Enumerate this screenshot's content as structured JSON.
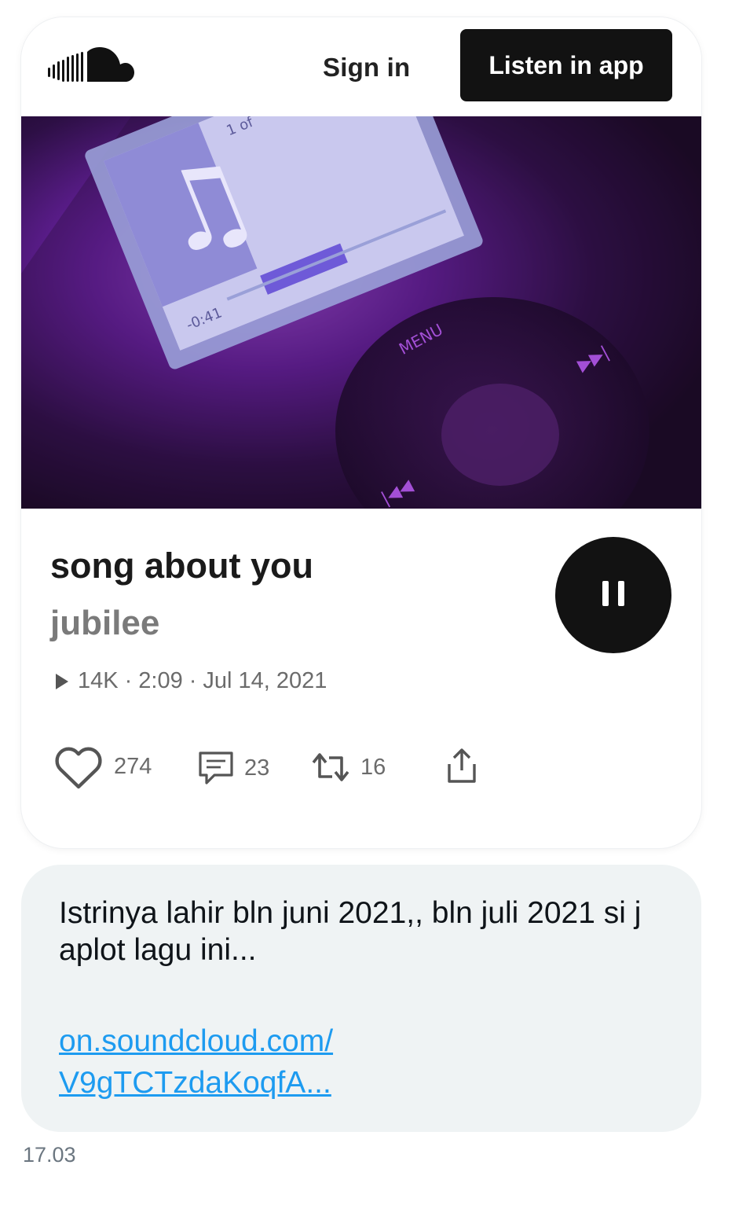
{
  "header": {
    "logo": "soundcloud-logo",
    "sign_in": "Sign in",
    "listen_in_app": "Listen in app"
  },
  "artwork": {
    "screen_time": "-0:41",
    "screen_counter": "1 of",
    "menu_label": "MENU"
  },
  "track": {
    "title": "song about you",
    "artist": "jubilee",
    "plays": "14K",
    "duration": "2:09",
    "date": "Jul 14, 2021",
    "separator": "·",
    "state": "playing"
  },
  "actions": {
    "likes": "274",
    "comments": "23",
    "reposts": "16",
    "share_icon": "share-icon"
  },
  "message": {
    "text": "Istrinya lahir bln juni 2021,, bln juli 2021 si j aplot lagu ini...",
    "link_line1": "on.soundcloud.com/",
    "link_line2": "V9gTCTzdaKoqfA..."
  },
  "timestamp": "17.03",
  "colors": {
    "button_dark": "#121212",
    "link": "#1d9bf0",
    "bubble": "#eff3f4",
    "artwork_purple": "#7a2bb8"
  }
}
